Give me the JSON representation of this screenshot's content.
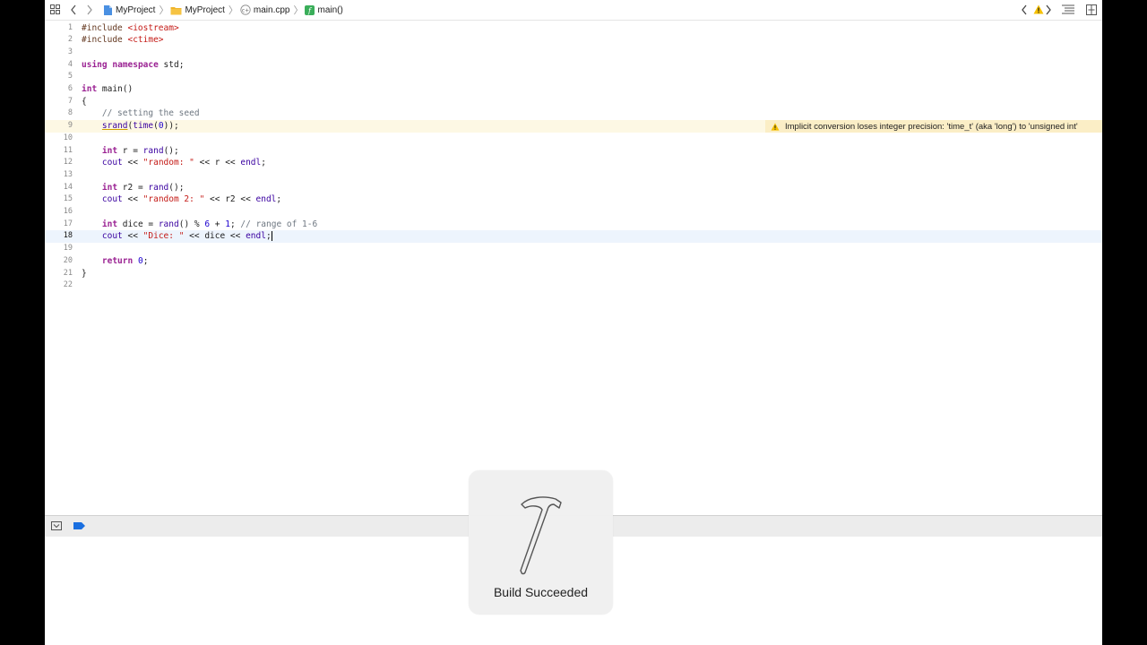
{
  "jumpbar": {
    "crumbs": [
      {
        "label": "MyProject",
        "icon": "project-file-icon"
      },
      {
        "label": "MyProject",
        "icon": "folder-icon"
      },
      {
        "label": "main.cpp",
        "icon": "cpp-file-icon"
      },
      {
        "label": "main()",
        "icon": "function-icon"
      }
    ]
  },
  "editor": {
    "lines": [
      {
        "n": "1"
      },
      {
        "n": "2"
      },
      {
        "n": "3"
      },
      {
        "n": "4"
      },
      {
        "n": "5"
      },
      {
        "n": "6"
      },
      {
        "n": "7"
      },
      {
        "n": "8"
      },
      {
        "n": "9"
      },
      {
        "n": "10"
      },
      {
        "n": "11"
      },
      {
        "n": "12"
      },
      {
        "n": "13"
      },
      {
        "n": "14"
      },
      {
        "n": "15"
      },
      {
        "n": "16"
      },
      {
        "n": "17"
      },
      {
        "n": "18"
      },
      {
        "n": "19"
      },
      {
        "n": "20"
      },
      {
        "n": "21"
      },
      {
        "n": "22"
      }
    ],
    "code": {
      "l1_pp": "#include ",
      "l1_str": "<iostream>",
      "l2_pp": "#include ",
      "l2_str": "<ctime>",
      "l4_kw1": "using",
      "l4_kw2": "namespace",
      "l4_rest": " std;",
      "l6_kw": "int",
      "l6_rest": " main()",
      "l7": "{",
      "l8_cm": "    // setting the seed",
      "l9_indent": "    ",
      "l9_fn1": "srand",
      "l9_p1": "(",
      "l9_fn2": "time",
      "l9_p2": "(",
      "l9_num": "0",
      "l9_p3": "));",
      "l11_indent": "    ",
      "l11_kw": "int",
      "l11_a": " r = ",
      "l11_fn": "rand",
      "l11_b": "();",
      "l12_indent": "    ",
      "l12_fn": "cout",
      "l12_a": " << ",
      "l12_str": "\"random: \"",
      "l12_b": " << r << ",
      "l12_fn2": "endl",
      "l12_c": ";",
      "l14_indent": "    ",
      "l14_kw": "int",
      "l14_a": " r2 = ",
      "l14_fn": "rand",
      "l14_b": "();",
      "l15_indent": "    ",
      "l15_fn": "cout",
      "l15_a": " << ",
      "l15_str": "\"random 2: \"",
      "l15_b": " << r2 << ",
      "l15_fn2": "endl",
      "l15_c": ";",
      "l17_indent": "    ",
      "l17_kw": "int",
      "l17_a": " dice = ",
      "l17_fn": "rand",
      "l17_b": "() % ",
      "l17_num1": "6",
      "l17_c": " + ",
      "l17_num2": "1",
      "l17_d": "; ",
      "l17_cm": "// range of 1-6",
      "l18_indent": "    ",
      "l18_fn": "cout",
      "l18_a": " << ",
      "l18_str": "\"Dice: \"",
      "l18_b": " << dice << ",
      "l18_fn2": "endl",
      "l18_c": ";",
      "l20_indent": "    ",
      "l20_kw": "return",
      "l20_a": " ",
      "l20_num": "0",
      "l20_b": ";",
      "l21": "}"
    },
    "warning_text": "Implicit conversion loses integer precision: 'time_t' (aka 'long') to 'unsigned int'"
  },
  "hud": {
    "label": "Build Succeeded",
    "icon": "hammer-icon"
  },
  "colors": {
    "keyword": "#9b2393",
    "string": "#c41a16",
    "comment": "#6e7781",
    "function": "#3900a0",
    "number": "#1c00cf",
    "warning": "#f5c000",
    "breakpoint_toggle": "#1a6fe0"
  }
}
